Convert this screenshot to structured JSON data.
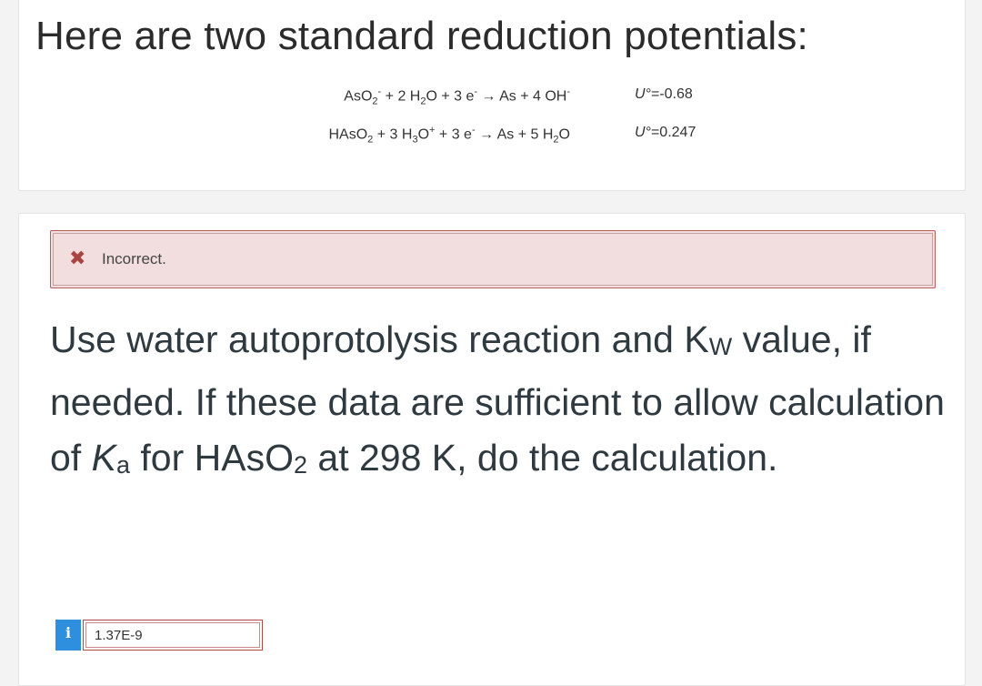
{
  "header": {
    "title": "Here are two standard reduction potentials:"
  },
  "reactions": [
    {
      "eq_html": "AsO<sub>2</sub><sup>-</sup> + 2 H<sub>2</sub>O + 3 e<sup>-</sup> → As + 4 OH<sup>-</sup>",
      "symbol": "U°",
      "value": "=-0.68"
    },
    {
      "eq_html": "HAsO<sub>2</sub> + 3 H<sub>3</sub>O<sup>+</sup> + 3 e<sup>-</sup> → As + 5 H<sub>2</sub>O",
      "symbol": "U°",
      "value": "=0.247"
    }
  ],
  "feedback": {
    "status": "Incorrect."
  },
  "question": {
    "text_html": "Use water autoprotolysis reaction and K<sub>W</sub> value, if needed. If these data are sufficient to allow calculation of <i>K</i><sub>a</sub> for HAsO<sub>2</sub> at 298 K, do the calculation."
  },
  "answer": {
    "value": "1.37E-9",
    "info_glyph": "i"
  },
  "colors": {
    "feedback_bg": "#f2dede",
    "feedback_border": "#b85c5c",
    "error_icon": "#a94442",
    "info_icon": "#2d8fde"
  }
}
